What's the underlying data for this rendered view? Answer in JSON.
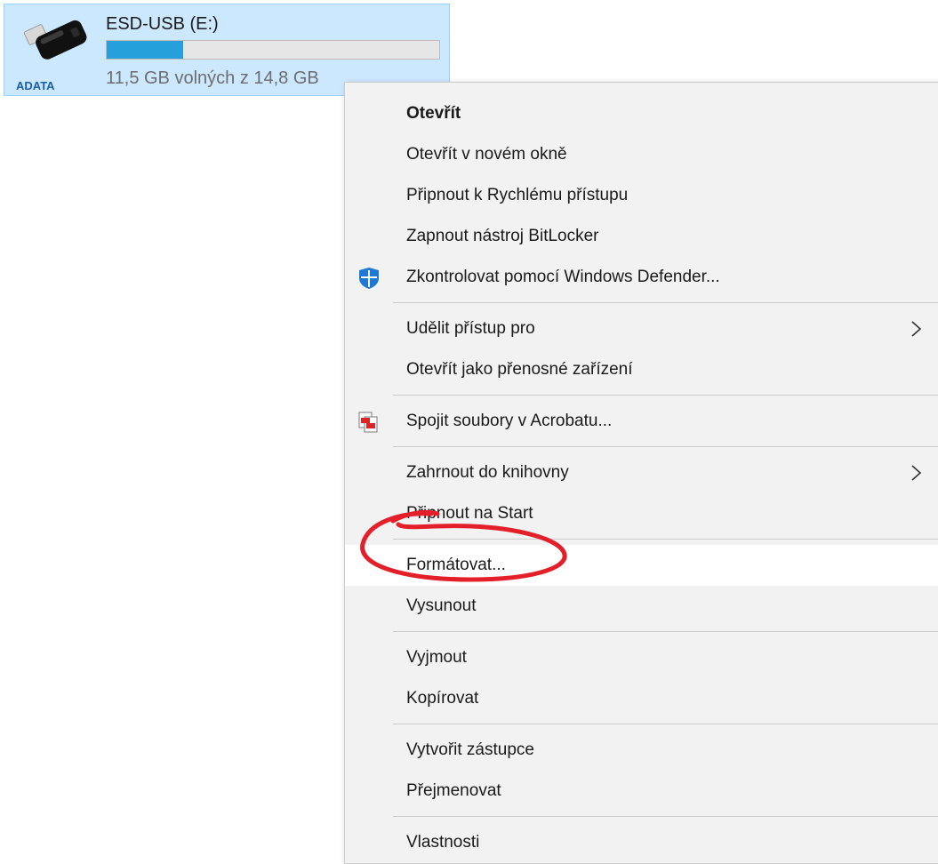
{
  "drive": {
    "name": "ESD-USB (E:)",
    "space_text": "11,5 GB volných z 14,8 GB",
    "brand_label": "ADATA",
    "used_fraction": 0.23,
    "bar_color": "#26a0da",
    "icon": "usb-drive-icon"
  },
  "context_menu": {
    "items": {
      "open": "Otevřít",
      "open_new_window": "Otevřít v novém okně",
      "pin_quick_access": "Připnout k Rychlému přístupu",
      "bitlocker": "Zapnout nástroj BitLocker",
      "defender": "Zkontrolovat pomocí Windows Defender...",
      "give_access": "Udělit přístup pro",
      "open_portable": "Otevřít jako přenosné zařízení",
      "acrobat_combine": "Spojit soubory v Acrobatu...",
      "include_library": "Zahrnout do knihovny",
      "pin_start": "Připnout na Start",
      "format": "Formátovat...",
      "eject": "Vysunout",
      "cut": "Vyjmout",
      "copy": "Kopírovat",
      "create_shortcut": "Vytvořit zástupce",
      "rename": "Přejmenovat",
      "properties": "Vlastnosti"
    },
    "icons": {
      "defender": "windows-defender-shield-icon",
      "acrobat": "acrobat-pdf-icon",
      "submenu": "chevron-right-icon"
    },
    "highlighted_item": "format",
    "annotation_color": "#e3202a"
  }
}
